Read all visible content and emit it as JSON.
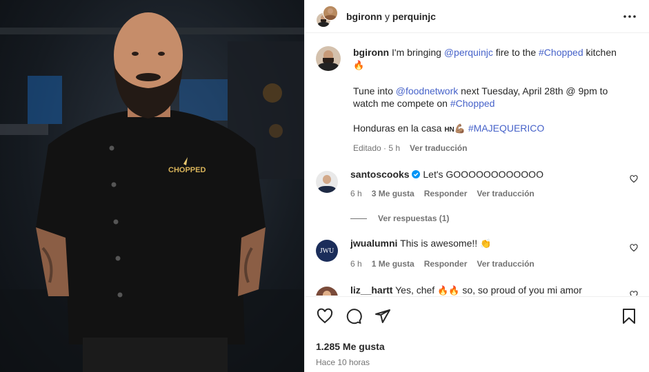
{
  "post": {
    "author": "bgironn",
    "connector": "y",
    "collaborator": "perquinjc",
    "caption": {
      "author": "bgironn",
      "line1_a": "I'm bringing",
      "mention1": "@perquinjc",
      "line1_b": "fire to the",
      "hashtag1": "#Chopped",
      "line1_c": "kitchen",
      "emoji1": "🔥",
      "line2_a": "Tune into",
      "mention2": "@foodnetwork",
      "line2_b": "next Tuesday, April 28th @ 9pm to watch me compete on",
      "hashtag2": "#Chopped",
      "line3_a": "Honduras en la casa",
      "flag": "HN",
      "emoji2": "💪🏽",
      "hashtag3": "#MAJEQUERICO",
      "edited": "Editado · 5 h",
      "translate": "Ver traducción"
    }
  },
  "comments": [
    {
      "user": "santoscooks",
      "verified": true,
      "text": "Let's GOOOOOOOOOOOO",
      "time": "6 h",
      "likes": "3 Me gusta",
      "reply": "Responder",
      "translate": "Ver traducción",
      "replies_label": "Ver respuestas (1)"
    },
    {
      "user": "jwualumni",
      "avatar_text": "JWU",
      "text": "This is awesome!!",
      "emoji": "👏",
      "time": "6 h",
      "likes": "1 Me gusta",
      "reply": "Responder",
      "translate": "Ver traducción"
    },
    {
      "user": "liz__hartt",
      "text_a": "Yes, chef",
      "emoji": "🔥🔥",
      "text_b": "so, so proud of you mi amor"
    }
  ],
  "footer": {
    "likes": "1.285 Me gusta",
    "time": "Hace 10 horas"
  },
  "photo": {
    "logo_text": "CHOPPED"
  },
  "icons": {
    "like": "heart-icon",
    "comment": "comment-icon",
    "share": "share-icon",
    "save": "bookmark-icon",
    "more": "more-icon"
  }
}
